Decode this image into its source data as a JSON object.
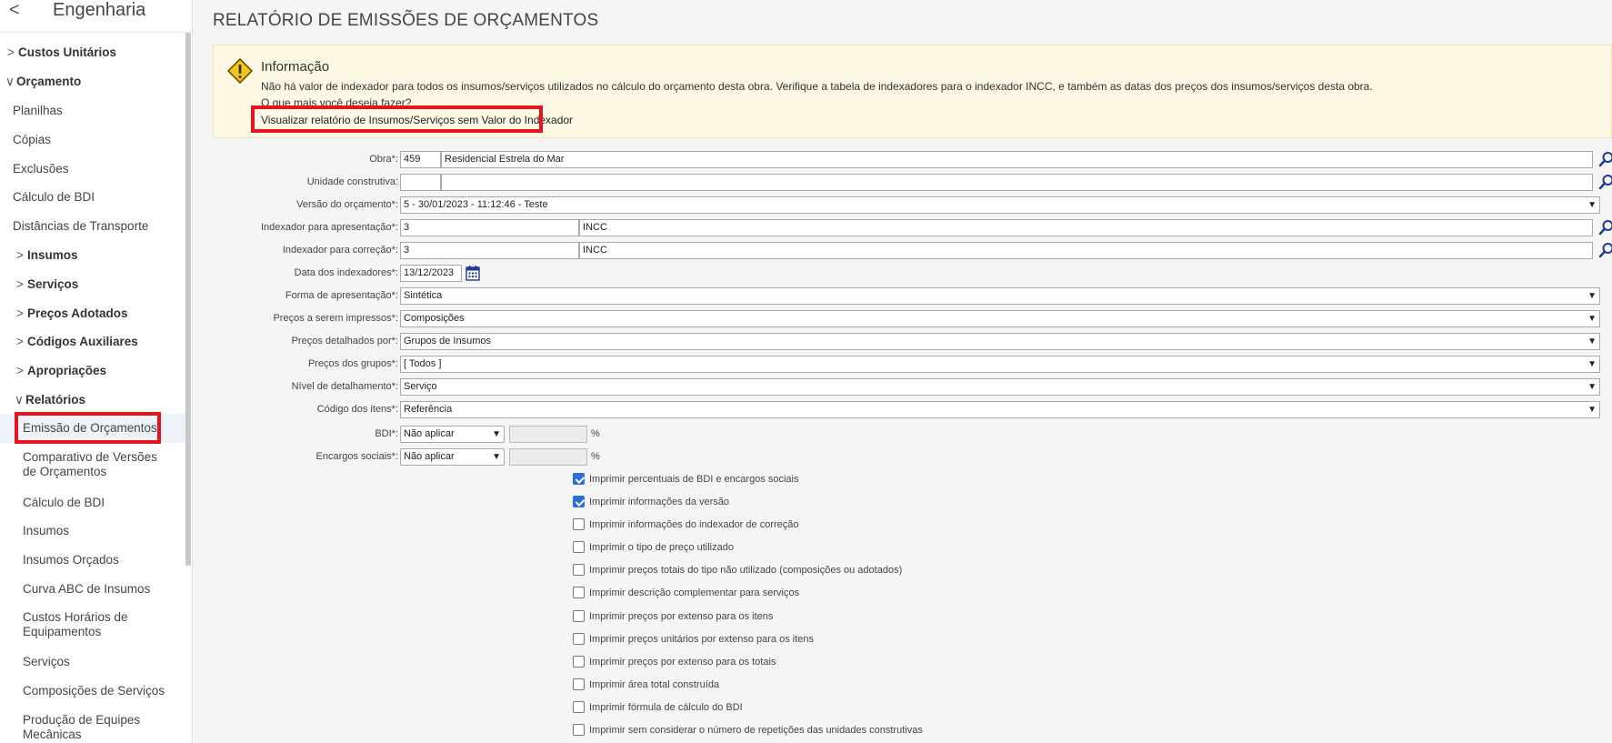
{
  "sidebar": {
    "back_icon": "chevron-left-icon",
    "title": "Engenharia",
    "items": [
      {
        "label": "Custos Unitários",
        "group": true,
        "chev": ">"
      },
      {
        "label": "Orçamento",
        "group": true,
        "chev": "∨"
      },
      {
        "label": "Planilhas"
      },
      {
        "label": "Cópias"
      },
      {
        "label": "Exclusões"
      },
      {
        "label": "Cálculo de BDI"
      },
      {
        "label": "Distâncias de Transporte"
      },
      {
        "label": "Insumos",
        "group": true,
        "chev": ">"
      },
      {
        "label": "Serviços",
        "group": true,
        "chev": ">"
      },
      {
        "label": "Preços Adotados",
        "group": true,
        "chev": ">"
      },
      {
        "label": "Códigos Auxiliares",
        "group": true,
        "chev": ">"
      },
      {
        "label": "Apropriações",
        "group": true,
        "chev": ">"
      },
      {
        "label": "Relatórios",
        "group": true,
        "chev": "∨"
      },
      {
        "label": "Emissão de Orçamentos",
        "active": true
      },
      {
        "label": "Comparativo de Versões",
        "label2": "de Orçamentos"
      },
      {
        "label": "Cálculo de BDI"
      },
      {
        "label": "Insumos"
      },
      {
        "label": "Insumos Orçados"
      },
      {
        "label": "Curva ABC de Insumos"
      },
      {
        "label": "Custos Horários de",
        "label2": "Equipamentos"
      },
      {
        "label": "Serviços"
      },
      {
        "label": "Composições de Serviços"
      },
      {
        "label": "Produção de Equipes",
        "label2": "Mecânicas"
      }
    ]
  },
  "page": {
    "title": "RELATÓRIO DE EMISSÕES DE ORÇAMENTOS"
  },
  "info": {
    "icon": "warning-icon",
    "title": "Informação",
    "text": "Não há valor de indexador para todos os insumos/serviços utilizados no cálculo do orçamento desta obra. Verifique a tabela de indexadores para o indexador INCC, e também as datas dos preços dos insumos/serviços desta obra.",
    "question": "O que mais você deseja fazer?",
    "link": "Visualizar relatório de Insumos/Serviços sem Valor do Indexador"
  },
  "form": {
    "obra": {
      "label": "Obra*:",
      "code": "459",
      "name": "Residencial Estrela do Mar"
    },
    "unidade": {
      "label": "Unidade construtiva:",
      "code": "",
      "name": ""
    },
    "versao": {
      "label": "Versão do orçamento*:",
      "value": "5 - 30/01/2023 - 11:12:46 - Teste"
    },
    "idx_apresentacao": {
      "label": "Indexador para apresentação*:",
      "code": "3",
      "name": "INCC"
    },
    "idx_correcao": {
      "label": "Indexador para correção*:",
      "code": "3",
      "name": "INCC"
    },
    "data_idx": {
      "label": "Data dos indexadores*:",
      "value": "13/12/2023"
    },
    "forma": {
      "label": "Forma de apresentação*:",
      "value": "Sintética"
    },
    "precos_impressos": {
      "label": "Preços a serem impressos*:",
      "value": "Composições"
    },
    "precos_detalhados": {
      "label": "Preços detalhados por*:",
      "value": "Grupos de Insumos"
    },
    "precos_grupos": {
      "label": "Preços dos grupos*:",
      "value": "[ Todos ]"
    },
    "nivel": {
      "label": "Nível de detalhamento*:",
      "value": "Serviço"
    },
    "codigo": {
      "label": "Código dos itens*:",
      "value": "Referência"
    },
    "bdi": {
      "label": "BDI*:",
      "value": "Não aplicar",
      "pct": "%"
    },
    "encargos": {
      "label": "Encargos sociais*:",
      "value": "Não aplicar",
      "pct": "%"
    }
  },
  "checkboxes": [
    {
      "label": "Imprimir percentuais de BDI e encargos sociais",
      "checked": true
    },
    {
      "label": "Imprimir informações da versão",
      "checked": true
    },
    {
      "label": "Imprimir informações do indexador de correção",
      "checked": false
    },
    {
      "label": "Imprimir o tipo de preço utilizado",
      "checked": false
    },
    {
      "label": "Imprimir preços totais do tipo não utilizado (composições ou adotados)",
      "checked": false
    },
    {
      "label": "Imprimir descrição complementar para serviços",
      "checked": false
    },
    {
      "label": "Imprimir preços por extenso para os itens",
      "checked": false
    },
    {
      "label": "Imprimir preços unitários por extenso para os itens",
      "checked": false
    },
    {
      "label": "Imprimir preços por extenso para os totais",
      "checked": false
    },
    {
      "label": "Imprimir área total construída",
      "checked": false
    },
    {
      "label": "Imprimir fórmula de cálculo do BDI",
      "checked": false
    },
    {
      "label": "Imprimir sem considerar o número de repetições das unidades construtivas",
      "checked": false
    }
  ],
  "colors": {
    "highlight": "#e8141d",
    "search_icon": "#1f3a93",
    "checkbox_on": "#2b6fd6"
  }
}
